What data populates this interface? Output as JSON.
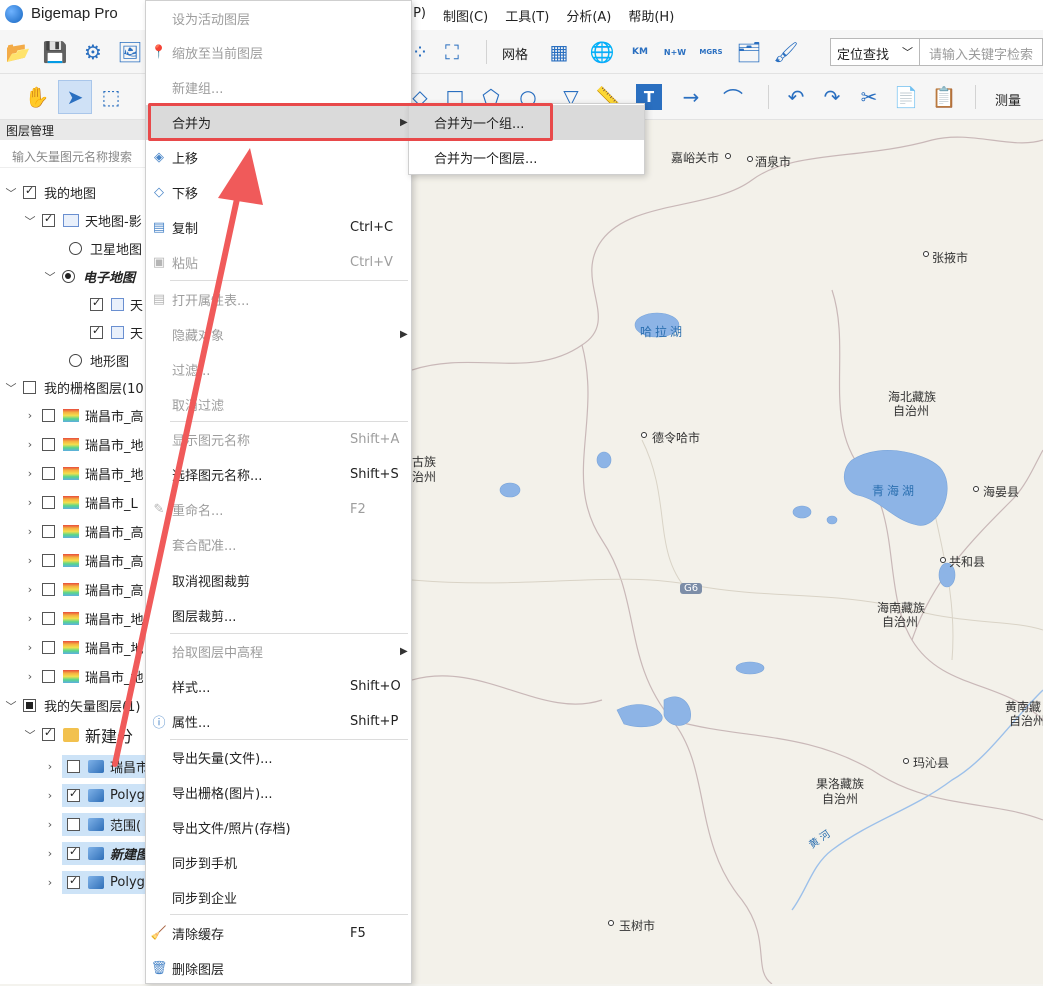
{
  "app": {
    "name": "Bigemap Pro"
  },
  "menubar": [
    "(P)",
    "制图(C)",
    "工具(T)",
    "分析(A)",
    "帮助(H)"
  ],
  "toolbar1": {
    "grid_label": "网格",
    "locate_select": "定位查找",
    "keyword_placeholder": "请输入关键字检索",
    "grid_buttons": [
      "KM",
      "N+W",
      "MGRS"
    ]
  },
  "toolbar2": {
    "measure_label": "测量"
  },
  "layer_panel": {
    "title": "图层管理",
    "search_placeholder": "输入矢量图元名称搜索",
    "rows": [
      {
        "label": "我的地图",
        "check": "on",
        "expand": "open"
      },
      {
        "label": "天地图-影",
        "check": "on",
        "expand": "open"
      },
      {
        "label": "卫星地图",
        "radio": "off"
      },
      {
        "label": "电子地图",
        "radio": "on",
        "expand": "open"
      },
      {
        "label": "天",
        "check": "on"
      },
      {
        "label": "天",
        "check": "on"
      },
      {
        "label": "地形图",
        "radio": "off"
      },
      {
        "label": "我的栅格图层(10",
        "check": "off",
        "expand": "open"
      },
      {
        "label": "瑞昌市_高",
        "check": "off",
        "expand": "closed"
      },
      {
        "label": "瑞昌市_地",
        "check": "off",
        "expand": "closed"
      },
      {
        "label": "瑞昌市_地",
        "check": "off",
        "expand": "closed"
      },
      {
        "label": "瑞昌市_L",
        "check": "off",
        "expand": "closed"
      },
      {
        "label": "瑞昌市_高",
        "check": "off",
        "expand": "closed"
      },
      {
        "label": "瑞昌市_高",
        "check": "off",
        "expand": "closed"
      },
      {
        "label": "瑞昌市_高",
        "check": "off",
        "expand": "closed"
      },
      {
        "label": "瑞昌市_地",
        "check": "off",
        "expand": "closed"
      },
      {
        "label": "瑞昌市_地",
        "check": "off",
        "expand": "closed"
      },
      {
        "label": "瑞昌市_地",
        "check": "off",
        "expand": "closed"
      },
      {
        "label": "我的矢量图层(1)",
        "check": "part",
        "expand": "open"
      },
      {
        "label": "新建分",
        "check": "on",
        "expand": "open"
      },
      {
        "label": "瑞昌市",
        "check": "off",
        "expand": "closed"
      },
      {
        "label": "Polyg",
        "check": "on",
        "expand": "closed"
      },
      {
        "label": "范围(",
        "check": "off",
        "expand": "closed"
      },
      {
        "label": "新建图",
        "check": "on",
        "expand": "closed"
      },
      {
        "label": "Polyg",
        "check": "on",
        "expand": "closed"
      }
    ]
  },
  "context_menu": {
    "items": [
      {
        "label": "设为活动图层",
        "disabled": true
      },
      {
        "label": "缩放至当前图层",
        "disabled": true
      },
      {
        "label": "新建组...",
        "disabled": true
      },
      {
        "label": "合并为",
        "submenu": true,
        "active": true
      },
      {
        "label": "上移"
      },
      {
        "label": "下移"
      },
      {
        "label": "复制",
        "shortcut": "Ctrl+C"
      },
      {
        "label": "粘贴",
        "shortcut": "Ctrl+V",
        "disabled": true
      },
      {
        "label": "打开属性表...",
        "disabled": true
      },
      {
        "label": "隐藏对象",
        "submenu": true,
        "disabled": true
      },
      {
        "label": "过滤...",
        "disabled": true
      },
      {
        "label": "取消过滤",
        "disabled": true
      },
      {
        "label": "显示图元名称",
        "shortcut": "Shift+A",
        "disabled": true
      },
      {
        "label": "选择图元名称...",
        "shortcut": "Shift+S"
      },
      {
        "label": "重命名...",
        "shortcut": "F2",
        "disabled": true
      },
      {
        "label": "套合配准...",
        "disabled": true
      },
      {
        "label": "取消视图裁剪"
      },
      {
        "label": "图层裁剪..."
      },
      {
        "label": "拾取图层中高程",
        "submenu": true,
        "disabled": true
      },
      {
        "label": "样式...",
        "shortcut": "Shift+O"
      },
      {
        "label": "属性...",
        "shortcut": "Shift+P"
      },
      {
        "label": "导出矢量(文件)..."
      },
      {
        "label": "导出栅格(图片)..."
      },
      {
        "label": "导出文件/照片(存档)"
      },
      {
        "label": "同步到手机"
      },
      {
        "label": "同步到企业"
      },
      {
        "label": "清除缓存",
        "shortcut": "F5"
      },
      {
        "label": "删除图层"
      }
    ],
    "submenu_items": [
      "合并为一个组...",
      "合并为一个图层..."
    ]
  },
  "map": {
    "labels": [
      "嘉峪关市",
      "酒泉市",
      "张掖市",
      "哈拉湖",
      "海北藏族",
      "自治州",
      "德令哈市",
      "古族",
      "治州",
      "青海湖",
      "海晏县",
      "共和县",
      "G6",
      "海南藏族",
      "自治州",
      "黄南藏",
      "自治州",
      "玛沁县",
      "果洛藏族",
      "自治州",
      "黄河",
      "玉树市"
    ]
  },
  "colors": {
    "annotation": "#e8494a",
    "selection": "#cde3f7",
    "water": "#8db4e6"
  }
}
